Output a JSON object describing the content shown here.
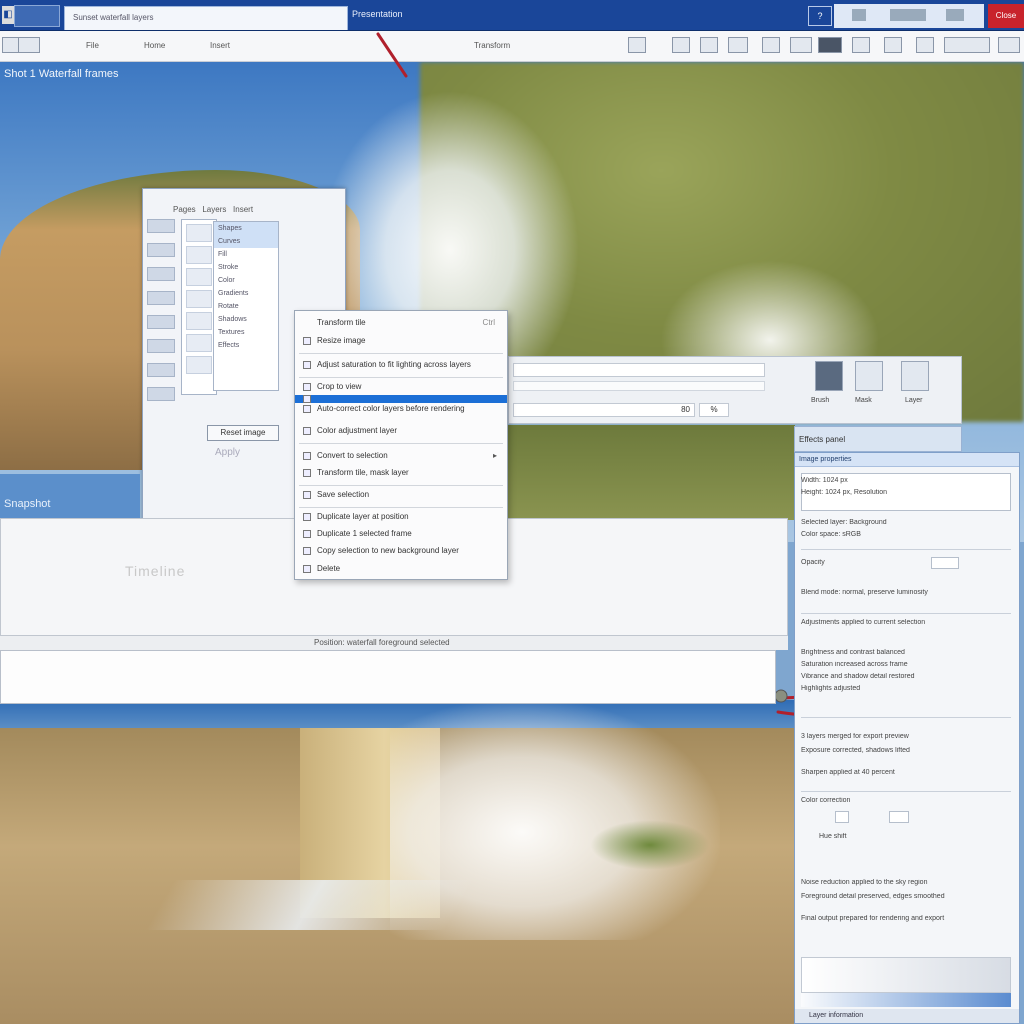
{
  "window": {
    "doc_tab_title": "Sunset waterfall layers",
    "title_text": "Presentation",
    "help_label": "?",
    "close_label": "Close"
  },
  "toolbar": {
    "left_items": [
      "File",
      "Home",
      "Insert"
    ],
    "center_label": "Transform"
  },
  "caption": "Shot 1 Waterfall frames",
  "dialog": {
    "tabs": [
      "Pages",
      "Layers",
      "Insert"
    ],
    "list_items": [
      "Shapes",
      "Curves",
      "Fill",
      "Stroke",
      "Color",
      "Gradients",
      "Rotate",
      "Shadows",
      "Textures",
      "Effects"
    ],
    "button_label": "Reset image",
    "field_value": "Apply"
  },
  "blue_bar_label": "Snapshot",
  "wide_panel": {
    "ghost_text": "Timeline",
    "status_text": "Position: waterfall foreground selected"
  },
  "strip": {
    "input_value": "80",
    "input_small": "%",
    "labels": [
      "Brush",
      "Mask",
      "Layer"
    ]
  },
  "context_menu": {
    "header": "Transform tile",
    "header_right": "Ctrl",
    "items": [
      {
        "label": "Resize image",
        "selected": false
      },
      {
        "label": "Adjust saturation to fit lighting across layers",
        "selected": false
      },
      {
        "label": "Crop to view",
        "selected": false
      },
      {
        "label": "Auto-correct color layers before rendering",
        "selected": true
      },
      {
        "label": "Color adjustment layer",
        "selected": false
      },
      {
        "label": "Convert to selection",
        "selected": false,
        "submenu": true
      },
      {
        "label": "Transform tile, mask layer",
        "selected": false
      },
      {
        "label": "Save selection",
        "selected": false
      },
      {
        "label": "Duplicate layer at position",
        "selected": false
      },
      {
        "label": "Duplicate 1 selected frame",
        "selected": false
      },
      {
        "label": "Copy selection to new background layer",
        "selected": false
      },
      {
        "label": "Delete",
        "selected": false
      }
    ]
  },
  "pane_header": "Effects panel",
  "properties": {
    "header": "Image properties",
    "lines": [
      "Width: 1024 px",
      "Height: 1024 px, Resolution",
      "Selected layer: Background",
      "Color space: sRGB",
      "Opacity",
      "Blend mode: normal, preserve luminosity",
      "Adjustments applied to current selection",
      "Brightness and contrast balanced",
      "Saturation increased across frame",
      "Vibrance and shadow detail restored",
      "Highlights adjusted",
      "3 layers merged for export preview",
      "Exposure corrected, shadows lifted",
      "Sharpen applied at 40 percent",
      "Color correction",
      "Hue shift",
      "Noise reduction applied to the sky region",
      "Foreground detail preserved, edges smoothed",
      "Final output prepared for rendering and export"
    ],
    "footer": "Layer information"
  },
  "colors": {
    "titlebar": "#1a4699",
    "menu_highlight": "#1c6fd6",
    "close_button": "#c8232c",
    "annotation_pen": "#b0202c"
  },
  "icons": [
    "app-icon",
    "help-icon",
    "close-icon",
    "brush-icon",
    "layer-icon",
    "mask-icon",
    "submenu-arrow-icon"
  ]
}
